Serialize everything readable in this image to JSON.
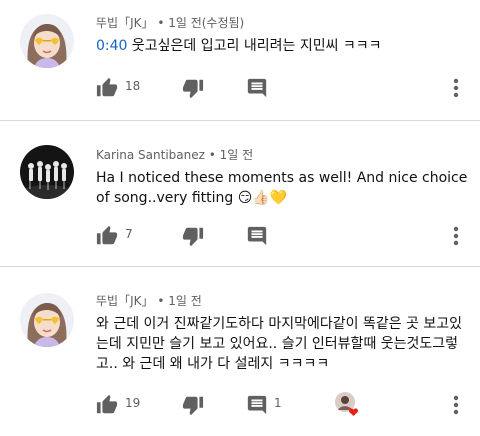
{
  "comments": [
    {
      "author": "뚜빕「JK」",
      "time": "1일 전(수정됨)",
      "timestamp_link": "0:40",
      "text": " 웃고싶은데 입고리 내리려는 지민씨 ㅋㅋㅋ",
      "likes": "18",
      "avatar_icon": "girl-with-heart-glasses-avatar"
    },
    {
      "author": "Karina Santibanez",
      "time": "1일 전",
      "text": "Ha I noticed these moments as well! And nice choice of song..very fitting 😏👍🏻💛",
      "likes": "7",
      "avatar_icon": "dance-group-stage-avatar"
    },
    {
      "author": "뚜빕「JK」",
      "time": "1일 전",
      "text": "와 근데 이거 진짜같기도하다 마지막에다같이 똑같은 곳 보고있는데 지민만 슬기 보고 있어요.. 슬기 인터뷰할때 웃는것도그렇고.. 와 근데 왜 내가 다 설레지 ㅋㅋㅋㅋ",
      "likes": "19",
      "replies": "1",
      "avatar_icon": "girl-with-heart-glasses-avatar"
    }
  ],
  "separator": " • ",
  "colors": {
    "link": "#1565c0",
    "meta": "#606060",
    "icon": "#606060",
    "heart": "#e62117"
  }
}
